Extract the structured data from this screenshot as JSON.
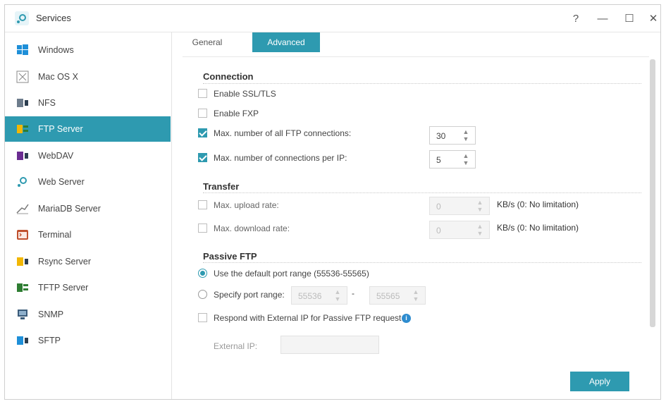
{
  "window": {
    "title": "Services",
    "controls": {
      "help": "?",
      "minimize": "—",
      "maximize": "☐",
      "close": "✕"
    }
  },
  "sidebar": {
    "items": [
      {
        "label": "Windows",
        "icon": "windows-icon"
      },
      {
        "label": "Mac OS X",
        "icon": "macos-icon"
      },
      {
        "label": "NFS",
        "icon": "nfs-icon"
      },
      {
        "label": "FTP Server",
        "icon": "ftp-icon",
        "active": true
      },
      {
        "label": "WebDAV",
        "icon": "webdav-icon"
      },
      {
        "label": "Web Server",
        "icon": "web-server-icon"
      },
      {
        "label": "MariaDB Server",
        "icon": "mariadb-icon"
      },
      {
        "label": "Terminal",
        "icon": "terminal-icon"
      },
      {
        "label": "Rsync Server",
        "icon": "rsync-icon"
      },
      {
        "label": "TFTP Server",
        "icon": "tftp-icon"
      },
      {
        "label": "SNMP",
        "icon": "snmp-icon"
      },
      {
        "label": "SFTP",
        "icon": "sftp-icon"
      }
    ]
  },
  "tabs": {
    "general": "General",
    "advanced": "Advanced",
    "active": "Advanced"
  },
  "connection": {
    "heading": "Connection",
    "ssl_label": "Enable SSL/TLS",
    "ssl_checked": false,
    "fxp_label": "Enable FXP",
    "fxp_checked": false,
    "max_all_label": "Max. number of all FTP connections:",
    "max_all_checked": true,
    "max_all_value": "30",
    "max_ip_label": "Max. number of connections per IP:",
    "max_ip_checked": true,
    "max_ip_value": "5"
  },
  "transfer": {
    "heading": "Transfer",
    "upload_label": "Max. upload rate:",
    "upload_checked": false,
    "upload_value": "0",
    "upload_unit": "KB/s (0: No limitation)",
    "download_label": "Max. download rate:",
    "download_checked": false,
    "download_value": "0",
    "download_unit": "KB/s (0: No limitation)"
  },
  "passive": {
    "heading": "Passive FTP",
    "default_range_label": "Use the default port range (55536-55565)",
    "specify_label": "Specify port range:",
    "port_from": "55536",
    "port_sep": "-",
    "port_to": "55565",
    "selected": "default",
    "external_ip_label": "Respond with External IP for Passive FTP request",
    "external_ip_checked": false,
    "external_ip_field_label": "External IP:",
    "external_ip_value": ""
  },
  "apply_label": "Apply",
  "colors": {
    "accent": "#2e9ab0",
    "info": "#2e8ccf"
  }
}
